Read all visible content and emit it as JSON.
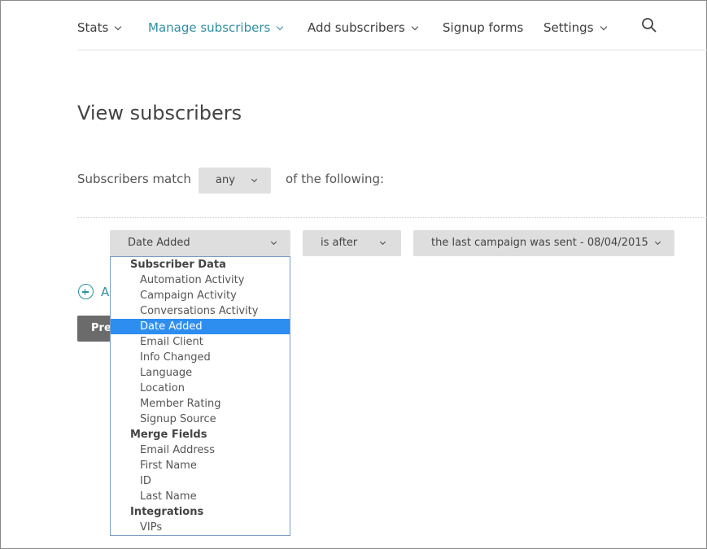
{
  "nav": {
    "items": [
      {
        "label": "Stats",
        "dropdown": true,
        "active": false
      },
      {
        "label": "Manage subscribers",
        "dropdown": true,
        "active": true
      },
      {
        "label": "Add subscribers",
        "dropdown": true,
        "active": false
      },
      {
        "label": "Signup forms",
        "dropdown": false,
        "active": false
      },
      {
        "label": "Settings",
        "dropdown": true,
        "active": false
      }
    ],
    "search_icon": "search-icon"
  },
  "page": {
    "title": "View subscribers"
  },
  "match": {
    "prefix": "Subscribers match",
    "value": "any",
    "suffix": "of the following:"
  },
  "condition": {
    "field": "Date Added",
    "operator": "is after",
    "value": "the last campaign was sent - 08/04/2015"
  },
  "add_condition": {
    "label": "A"
  },
  "preview_button": {
    "label": "Pre"
  },
  "dropdown": {
    "groups": [
      {
        "label": "Subscriber Data",
        "options": [
          {
            "label": "Automation Activity"
          },
          {
            "label": "Campaign Activity"
          },
          {
            "label": "Conversations Activity"
          },
          {
            "label": "Date Added",
            "selected": true
          },
          {
            "label": "Email Client"
          },
          {
            "label": "Info Changed"
          },
          {
            "label": "Language"
          },
          {
            "label": "Location"
          },
          {
            "label": "Member Rating"
          },
          {
            "label": "Signup Source"
          }
        ]
      },
      {
        "label": "Merge Fields",
        "options": [
          {
            "label": "Email Address"
          },
          {
            "label": "First Name"
          },
          {
            "label": "ID"
          },
          {
            "label": "Last Name"
          }
        ]
      },
      {
        "label": "Integrations",
        "options": [
          {
            "label": "VIPs"
          }
        ]
      }
    ]
  },
  "colors": {
    "accent": "#2f8fa3",
    "selected_option_bg": "#2e8ef0",
    "select_bg": "#dedede",
    "preview_bg": "#6b6b6b"
  }
}
